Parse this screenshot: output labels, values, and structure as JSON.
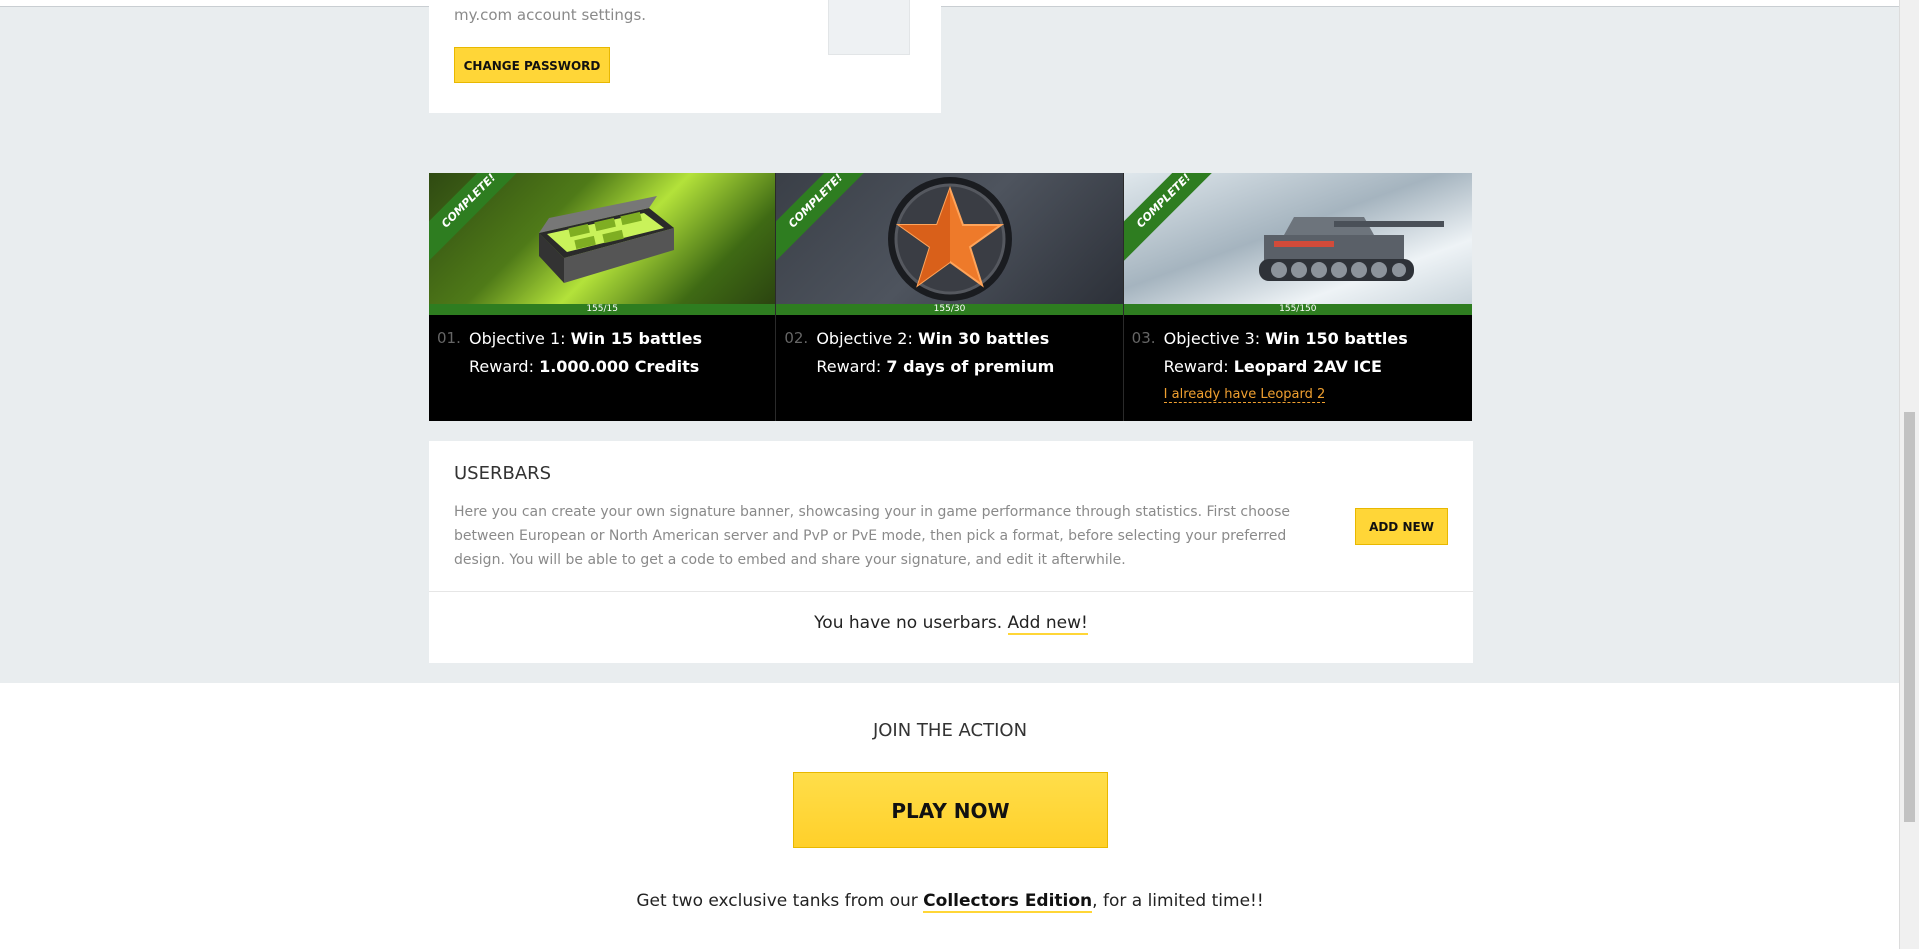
{
  "account": {
    "settings_text": "my.com account settings.",
    "change_password_label": "CHANGE PASSWORD"
  },
  "objectives": [
    {
      "ribbon": "COMPLETE!",
      "progress": "155/15",
      "progress_fraction": 1.0,
      "number": "01.",
      "objective_prefix": "Objective 1:",
      "objective_bold": "Win 15 battles",
      "reward_prefix": "Reward:",
      "reward_bold": "1.000.000 Credits",
      "image": "credits-case-icon"
    },
    {
      "ribbon": "COMPLETE!",
      "progress": "155/30",
      "progress_fraction": 1.0,
      "number": "02.",
      "objective_prefix": "Objective 2:",
      "objective_bold": "Win 30 battles",
      "reward_prefix": "Reward:",
      "reward_bold": "7 days of premium",
      "image": "premium-star-icon"
    },
    {
      "ribbon": "COMPLETE!",
      "progress": "155/150",
      "progress_fraction": 1.0,
      "number": "03.",
      "objective_prefix": "Objective 3:",
      "objective_bold": "Win 150 battles",
      "reward_prefix": "Reward:",
      "reward_bold": "Leopard 2AV ICE",
      "extra_link": "I already have Leopard 2",
      "image": "leopard-tank-icon"
    }
  ],
  "userbars": {
    "title": "USERBARS",
    "description": "Here you can create your own signature banner, showcasing your in game performance through statistics. First choose between European or North American server and PvP or PvE mode, then pick a format, before selecting your preferred design. You will be able to get a code to embed and share your signature, and edit it afterwhile.",
    "add_new_label": "ADD NEW",
    "empty_text": "You have no userbars.",
    "empty_link": "Add new!"
  },
  "footer": {
    "join_title": "JOIN THE ACTION",
    "play_now_label": "PLAY NOW",
    "promo_prefix": "Get two exclusive tanks from our",
    "promo_link": "Collectors Edition",
    "promo_suffix": ", for a limited time!!"
  },
  "colors": {
    "accent_yellow": "#ffd637",
    "complete_green": "#2e7d20",
    "link_orange": "#f0a030",
    "page_bg": "#e9edef"
  }
}
